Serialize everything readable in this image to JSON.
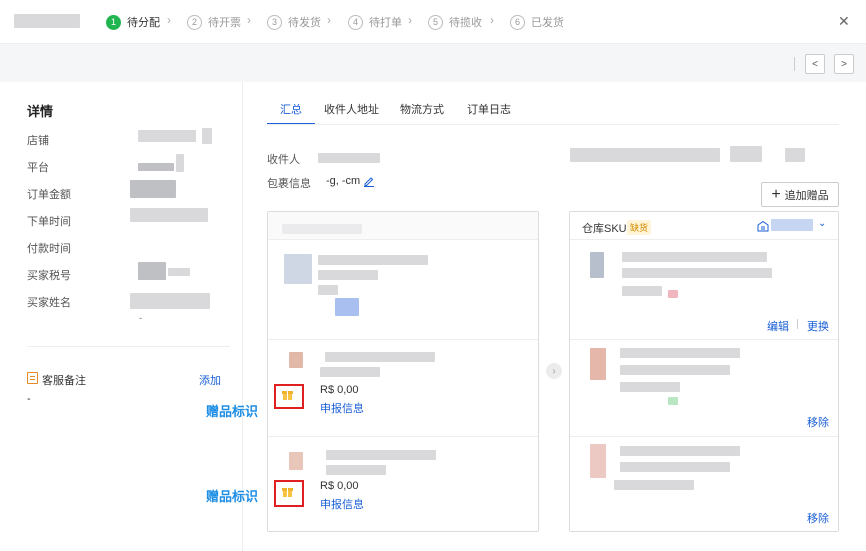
{
  "header": {
    "steps": [
      {
        "num": "1",
        "label": "待分配"
      },
      {
        "num": "2",
        "label": "待开票"
      },
      {
        "num": "3",
        "label": "待发货"
      },
      {
        "num": "4",
        "label": "待打单"
      },
      {
        "num": "5",
        "label": "待揽收"
      },
      {
        "num": "6",
        "label": "已发货"
      }
    ],
    "close": "✕"
  },
  "toolbar": {
    "prev": "<",
    "next": ">"
  },
  "details": {
    "title": "详情",
    "fields": [
      "店铺",
      "平台",
      "订单金额",
      "下单时间",
      "付款时间",
      "买家税号",
      "买家姓名"
    ],
    "dash": "-",
    "remark_label": "客服备注",
    "remark_add": "添加",
    "remark_value": "-"
  },
  "tabs": [
    "汇总",
    "收件人地址",
    "物流方式",
    "订单日志"
  ],
  "summary": {
    "recipient_label": "收件人",
    "package_label": "包裹信息",
    "package_value": "-g, -cm",
    "add_gift": "追加赠品"
  },
  "warehouse": {
    "title": "仓库SKU",
    "badge": "缺货"
  },
  "items": [
    {
      "price": "R$ 0,00",
      "declare": "申报信息"
    },
    {
      "price": "R$ 0,00",
      "declare": "申报信息"
    }
  ],
  "sku_actions": {
    "edit": "编辑",
    "replace": "更换",
    "remove": "移除"
  },
  "annotations": {
    "gift_mark": "赠品标识"
  },
  "colors": {
    "accent": "#1a5fd6",
    "success": "#21b550",
    "highlight": "#e02020",
    "annotation": "#1f8fe6"
  }
}
